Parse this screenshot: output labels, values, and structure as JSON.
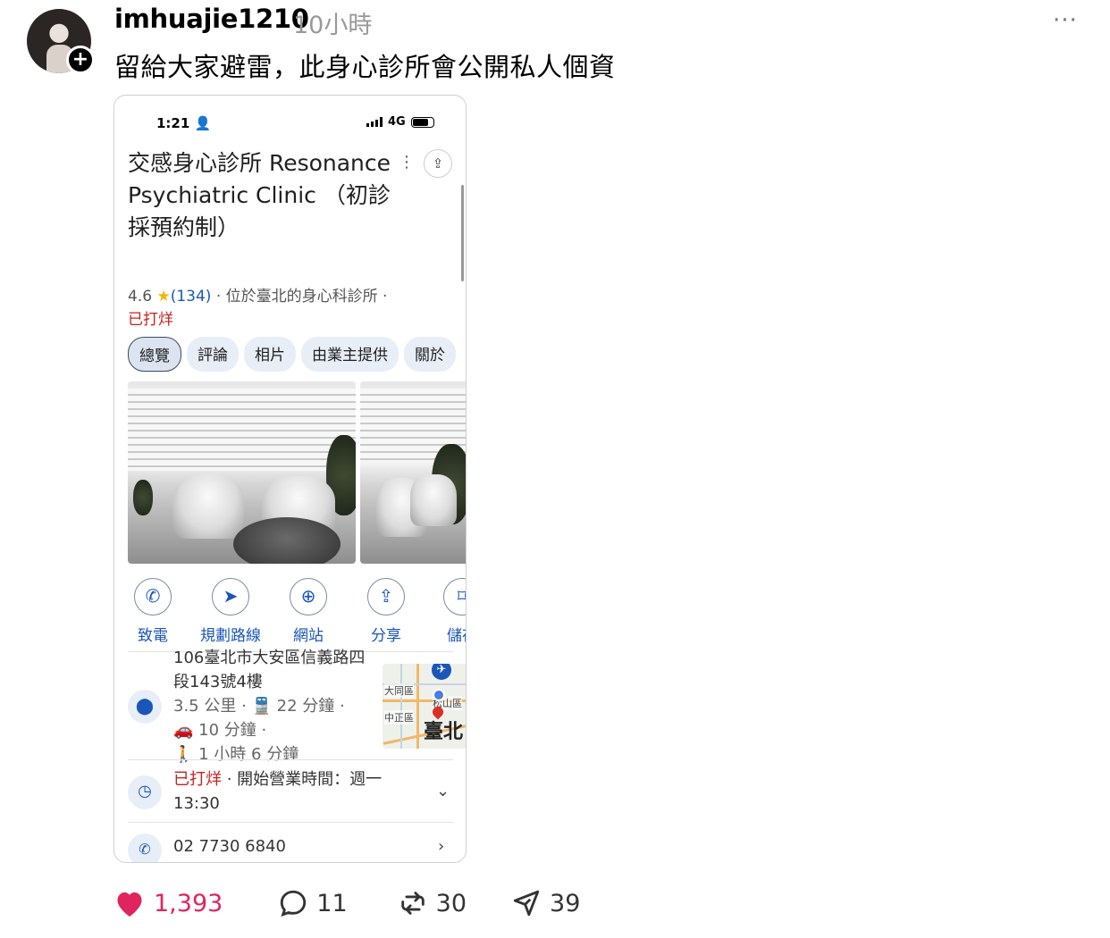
{
  "post": {
    "username": "imhuajie1210",
    "timestamp": "10小時",
    "more": "···",
    "follow": "+",
    "caption": "留給大家避雷，此身心診所會公開私人個資"
  },
  "screenshot": {
    "status_bar": {
      "time": "1:21",
      "network": "4G"
    },
    "place": {
      "title": "交感身心診所 Resonance Psychiatric Clinic （初診採預約制）",
      "rating": "4.6",
      "reviews": "(134)",
      "category": "· 位於臺北的身心科診所 ·",
      "status": "已打烊"
    },
    "tabs": [
      "總覽",
      "評論",
      "相片",
      "由業主提供",
      "關於"
    ],
    "actions": [
      {
        "label": "致電",
        "icon": "phone-icon",
        "glyph": "✆"
      },
      {
        "label": "規劃路線",
        "icon": "directions-icon",
        "glyph": "➤"
      },
      {
        "label": "網站",
        "icon": "globe-icon",
        "glyph": "🌐"
      },
      {
        "label": "分享",
        "icon": "share-icon",
        "glyph": "⇪"
      },
      {
        "label": "儲存",
        "icon": "bookmark-icon",
        "glyph": "⌑"
      }
    ],
    "address": {
      "line": "106臺北市大安區信義路四段143號4樓",
      "transit": "3.5 公里 · 🚆 22 分鐘 ·",
      "drive": "🚗 10 分鐘 ·",
      "walk": "🚶 1 小時 6 分鐘"
    },
    "map": {
      "labels": [
        "大同區",
        "松山區",
        "中正區"
      ],
      "city": "臺北"
    },
    "hours": {
      "status": "已打烊",
      "next": " · 開始營業時間：週一",
      "time": "13:30"
    },
    "phone": "02 7730 6840"
  },
  "footer": {
    "likes": "1,393",
    "comments": "11",
    "reposts": "30",
    "shares": "39",
    "colors": {
      "like": "#e0245e"
    }
  }
}
